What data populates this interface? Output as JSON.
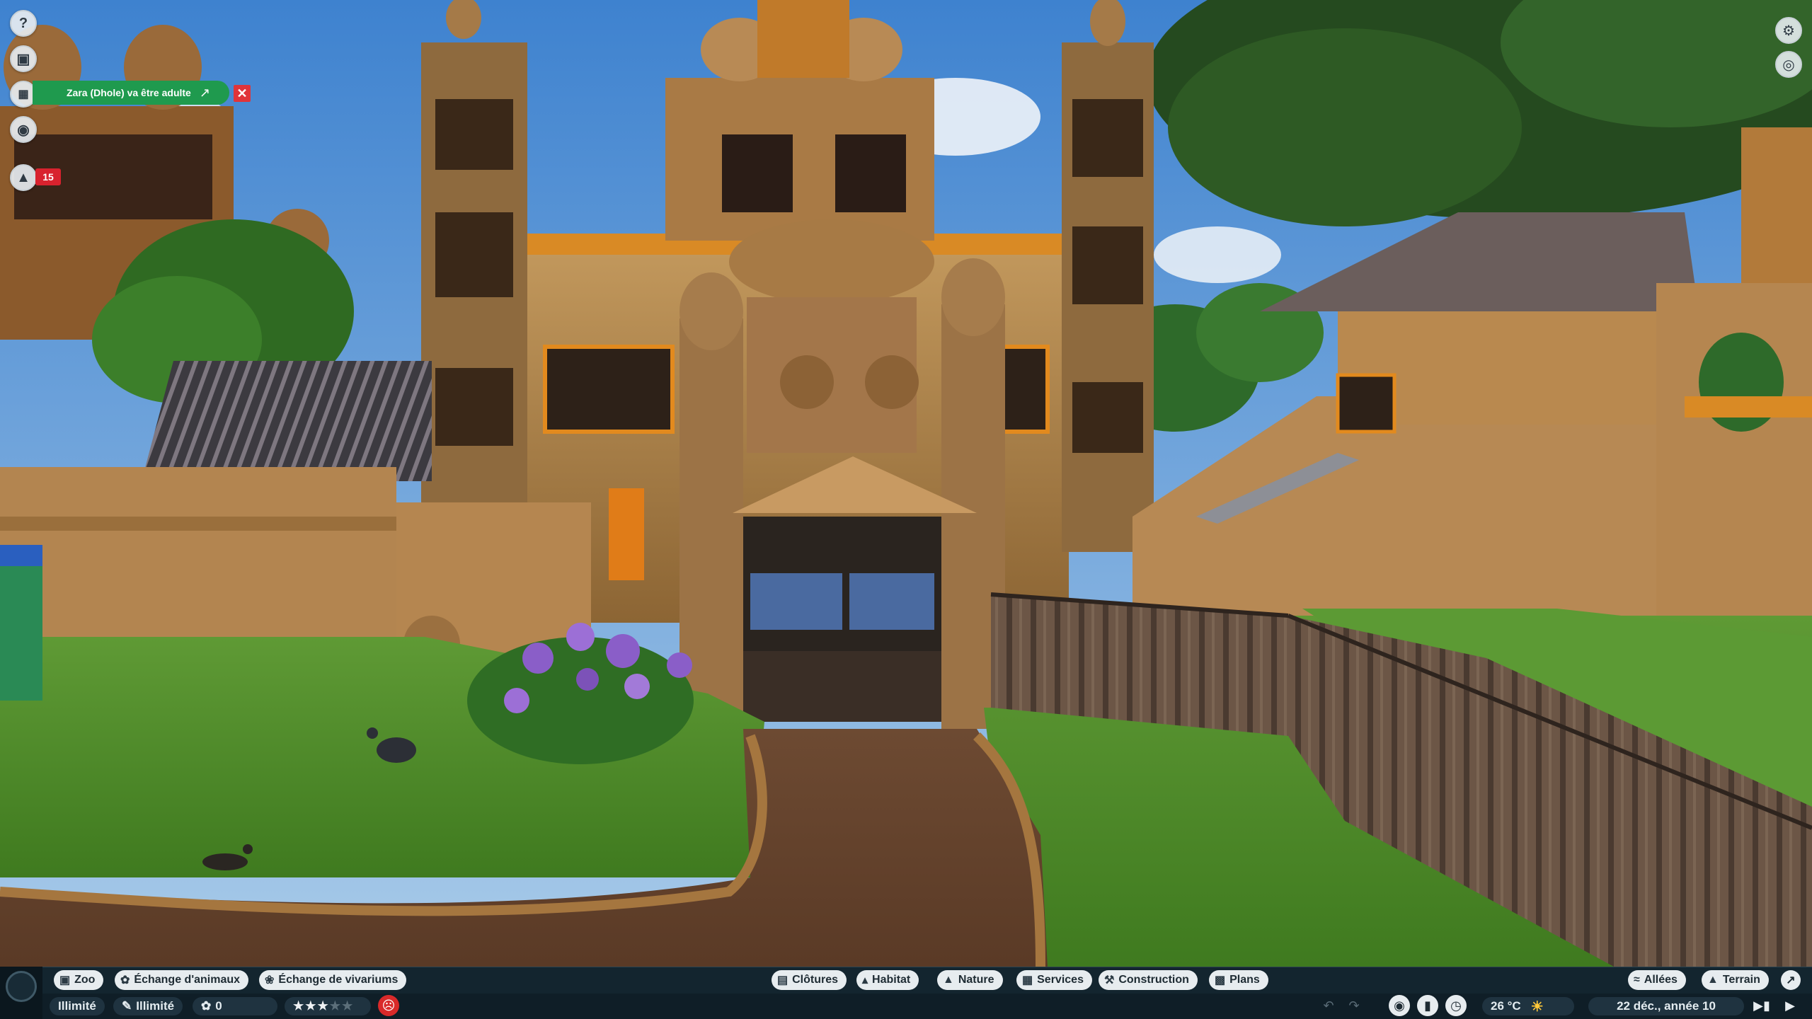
{
  "notification": {
    "text": "Zara (Dhole) va être adulte",
    "external_icon": "external-link-icon",
    "close_symbol": "✕"
  },
  "left_icons": [
    "help-icon",
    "animal-info-icon",
    "calendar-icon",
    "vision-icon",
    "guests-icon"
  ],
  "guest_badge": "15",
  "right_icons": [
    "settings-icon",
    "camera-icon"
  ],
  "toolbar_top": {
    "left_tabs": [
      {
        "label": "Zoo",
        "icon": "zoo-icon"
      },
      {
        "label": "Échange d'animaux",
        "icon": "paw-icon"
      },
      {
        "label": "Échange de vivariums",
        "icon": "bug-icon"
      }
    ],
    "build_tabs": [
      {
        "label": "Clôtures",
        "icon": "fence-icon"
      },
      {
        "label": "Habitat",
        "icon": "habitat-icon"
      },
      {
        "label": "Nature",
        "icon": "tree-icon"
      },
      {
        "label": "Services",
        "icon": "shop-icon"
      },
      {
        "label": "Construction",
        "icon": "build-icon"
      },
      {
        "label": "Plans",
        "icon": "blueprint-icon"
      }
    ],
    "right_tabs": [
      {
        "label": "Allées",
        "icon": "path-icon"
      },
      {
        "label": "Terrain",
        "icon": "terrain-icon"
      }
    ]
  },
  "status_bar": {
    "money": "Illimité",
    "research": "Illimité",
    "conservation_credits": "0",
    "rating_stars": 3,
    "rating_max": 5,
    "temperature": "26 °C",
    "weather_icon": "sun-icon",
    "date": "22 déc., année 10"
  },
  "colors": {
    "notification_bg": "#1f9a4e",
    "close_bg": "#e0343a",
    "badge_bg": "#d8222e",
    "bar_bg": "#13252f"
  }
}
